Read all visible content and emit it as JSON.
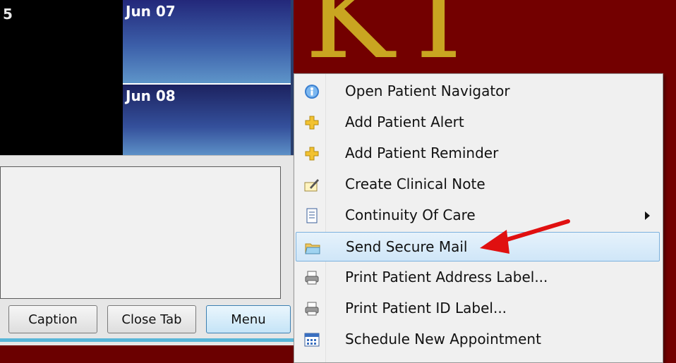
{
  "calendar": {
    "fragment_text": "5",
    "days": [
      "Jun 07",
      "Jun 08"
    ]
  },
  "buttons": {
    "caption": "Caption",
    "close_tab": "Close Tab",
    "menu": "Menu"
  },
  "background": {
    "letters": "KT"
  },
  "context_menu": {
    "items": [
      {
        "label": "Open Patient Navigator",
        "icon": "navigator-globe-icon"
      },
      {
        "label": "Add Patient Alert",
        "icon": "plus-icon"
      },
      {
        "label": "Add Patient Reminder",
        "icon": "plus-icon"
      },
      {
        "label": "Create Clinical Note",
        "icon": "pencil-note-icon"
      },
      {
        "label": "Continuity Of Care",
        "icon": "document-icon",
        "has_submenu": true
      },
      {
        "label": "Send Secure Mail",
        "icon": "mail-folder-icon",
        "highlighted": true
      },
      {
        "label": "Print Patient Address Label...",
        "icon": "printer-icon"
      },
      {
        "label": "Print Patient ID Label...",
        "icon": "printer-icon"
      },
      {
        "label": "Schedule New Appointment",
        "icon": "calendar-icon"
      }
    ]
  },
  "colors": {
    "menu_highlight": "#cfe6f8",
    "annotation_arrow": "#e01010",
    "background_maroon": "#730000",
    "gold": "#c9a521"
  }
}
